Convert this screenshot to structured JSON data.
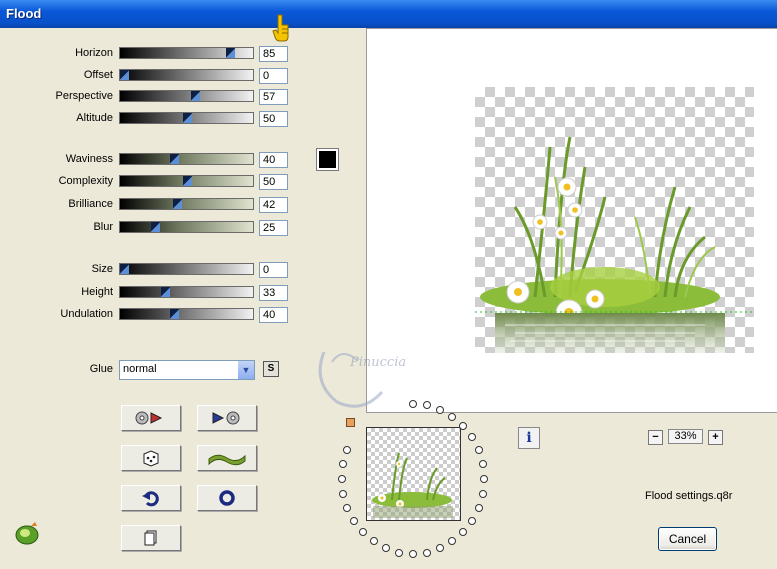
{
  "window": {
    "title": "Flood"
  },
  "sliders": [
    {
      "label": "Horizon",
      "value": "85",
      "color": "gray"
    },
    {
      "label": "Offset",
      "value": "0",
      "color": "gray"
    },
    {
      "label": "Perspective",
      "value": "57",
      "color": "gray"
    },
    {
      "label": "Altitude",
      "value": "50",
      "color": "gray"
    },
    {
      "label": "Waviness",
      "value": "40",
      "color": "green"
    },
    {
      "label": "Complexity",
      "value": "50",
      "color": "green"
    },
    {
      "label": "Brilliance",
      "value": "42",
      "color": "green"
    },
    {
      "label": "Blur",
      "value": "25",
      "color": "green"
    },
    {
      "label": "Size",
      "value": "0",
      "color": "gray"
    },
    {
      "label": "Height",
      "value": "33",
      "color": "gray"
    },
    {
      "label": "Undulation",
      "value": "40",
      "color": "gray"
    }
  ],
  "color_swatch": "#000000",
  "glue": {
    "label": "Glue",
    "value": "normal",
    "s_button": "S"
  },
  "buttons": {
    "load_left": "load-preset-icon",
    "load_right": "save-preset-icon",
    "random": "dice-icon",
    "wave": "wave-icon",
    "undo": "undo-arrow-icon",
    "reset": "ring-icon",
    "copy": "copy-icon"
  },
  "zoom": {
    "value": "33%",
    "minus": "−",
    "plus": "+"
  },
  "settings_file": "Flood settings.q8r",
  "cancel_label": "Cancel",
  "info_label": "i",
  "watermark": "Pinuccia"
}
